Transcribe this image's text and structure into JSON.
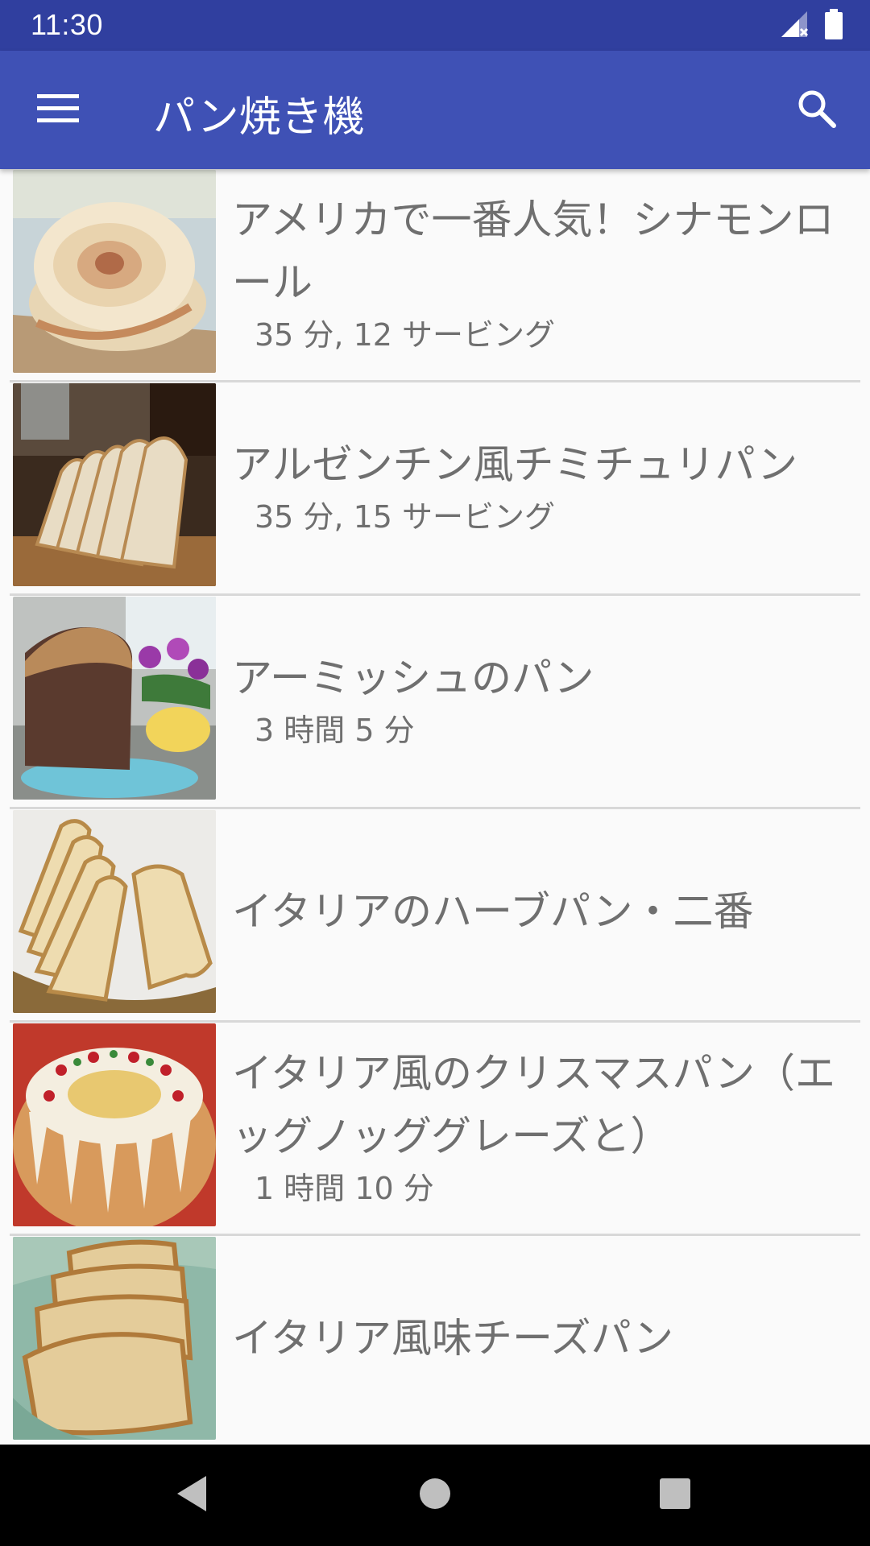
{
  "status_bar": {
    "time": "11:30",
    "icons": [
      "signal-icon",
      "battery-icon"
    ]
  },
  "app_bar": {
    "title": "パン焼き機",
    "menu_icon": "menu-icon",
    "search_icon": "search-icon",
    "color": "#3f51b5"
  },
  "recipes": [
    {
      "title": "アメリカで一番人気！シナモンロール",
      "subtitle": "35 分, 12 サービング",
      "image": "cinnamon-roll-image"
    },
    {
      "title": "アルゼンチン風チミチュリパン",
      "subtitle": "35 分, 15 サービング",
      "image": "sliced-bread-image"
    },
    {
      "title": "アーミッシュのパン",
      "subtitle": "3 時間 5 分",
      "image": "bread-loaf-image"
    },
    {
      "title": "イタリアのハーブパン・二番",
      "subtitle": "",
      "image": "herb-bread-slices-image"
    },
    {
      "title": "イタリア風のクリスマスパン（エッグノッググレーズと）",
      "subtitle": "1 時間 10 分",
      "image": "christmas-bundt-bread-image"
    },
    {
      "title": "イタリア風味チーズパン",
      "subtitle": "",
      "image": "cheese-bread-image"
    }
  ],
  "nav_bar": {
    "back_icon": "back-icon",
    "home_icon": "home-icon",
    "recents_icon": "recents-icon"
  }
}
